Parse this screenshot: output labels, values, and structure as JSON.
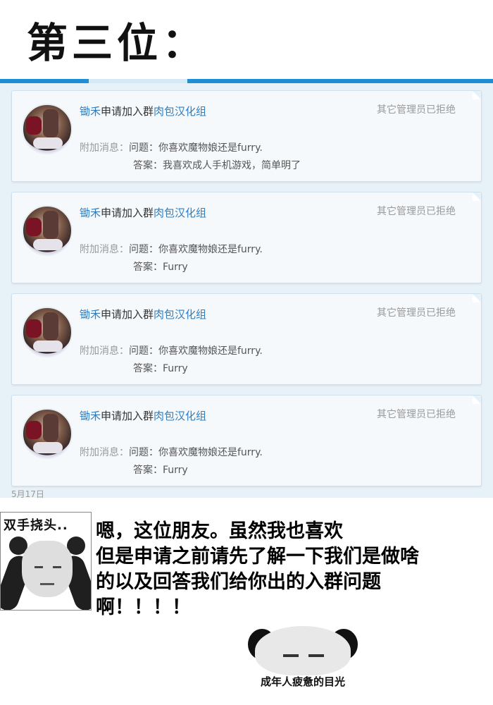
{
  "header": {
    "title": "第三位："
  },
  "requests": [
    {
      "user": "锄禾",
      "action": "申请加入群",
      "group": "肉包汉化组",
      "status": "其它管理员已拒绝",
      "msg_label": "附加消息：",
      "question": "问题：你喜欢魔物娘还是furry.",
      "answer": "答案：我喜欢成人手机游戏，简单明了"
    },
    {
      "user": "锄禾",
      "action": "申请加入群",
      "group": "肉包汉化组",
      "status": "其它管理员已拒绝",
      "msg_label": "附加消息：",
      "question": "问题：你喜欢魔物娘还是furry.",
      "answer": "答案：Furry"
    },
    {
      "user": "锄禾",
      "action": "申请加入群",
      "group": "肉包汉化组",
      "status": "其它管理员已拒绝",
      "msg_label": "附加消息：",
      "question": "问题：你喜欢魔物娘还是furry.",
      "answer": "答案：Furry"
    },
    {
      "user": "锄禾",
      "action": "申请加入群",
      "group": "肉包汉化组",
      "status": "其它管理员已拒绝",
      "msg_label": "附加消息：",
      "question": "问题：你喜欢魔物娘还是furry.",
      "answer": "答案：Furry"
    }
  ],
  "date_partial": "5月17日",
  "meme1": {
    "caption": "双手挠头.."
  },
  "speech": {
    "line1": "嗯，这位朋友。虽然我也喜欢",
    "line2": "但是申请之前请先了解一下我们是做啥",
    "line3": "的以及回答我们给你出的入群问题",
    "line4": "啊！！！！"
  },
  "meme2": {
    "caption": "成年人疲惫的目光"
  },
  "colors": {
    "accent": "#1b8ed6",
    "link": "#2b7fc4",
    "panel_bg": "#e7f1f8"
  }
}
